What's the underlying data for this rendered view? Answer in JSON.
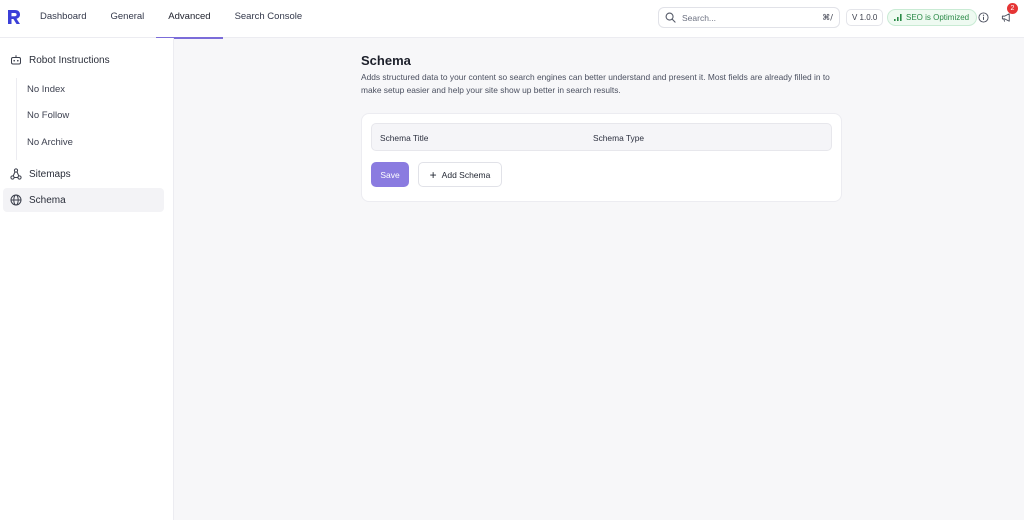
{
  "nav": {
    "tabs": [
      {
        "label": "Dashboard"
      },
      {
        "label": "General"
      },
      {
        "label": "Advanced"
      },
      {
        "label": "Search Console"
      }
    ],
    "active_tab": "Advanced"
  },
  "header": {
    "search_placeholder": "Search...",
    "search_shortcut": "⌘/",
    "version": "V 1.0.0",
    "seo_status": "SEO is Optimized",
    "notification_count": "2"
  },
  "sidebar": {
    "robot_instructions": "Robot Instructions",
    "sub_items": [
      {
        "label": "No Index"
      },
      {
        "label": "No Follow"
      },
      {
        "label": "No Archive"
      }
    ],
    "sitemaps": "Sitemaps",
    "schema": "Schema"
  },
  "main": {
    "title": "Schema",
    "description": "Adds structured data to your content so search engines can better understand and present it. Most fields are already filled in to make setup easier and help your site show up better in search results.",
    "table_headers": {
      "title": "Schema Title",
      "type": "Schema Type"
    },
    "save_label": "Save",
    "add_label": "Add Schema"
  },
  "colors": {
    "accent": "#7b6cd9",
    "save_button": "#8a7be0",
    "seo_green": "#2a8a47",
    "notification_red": "#e53535"
  }
}
